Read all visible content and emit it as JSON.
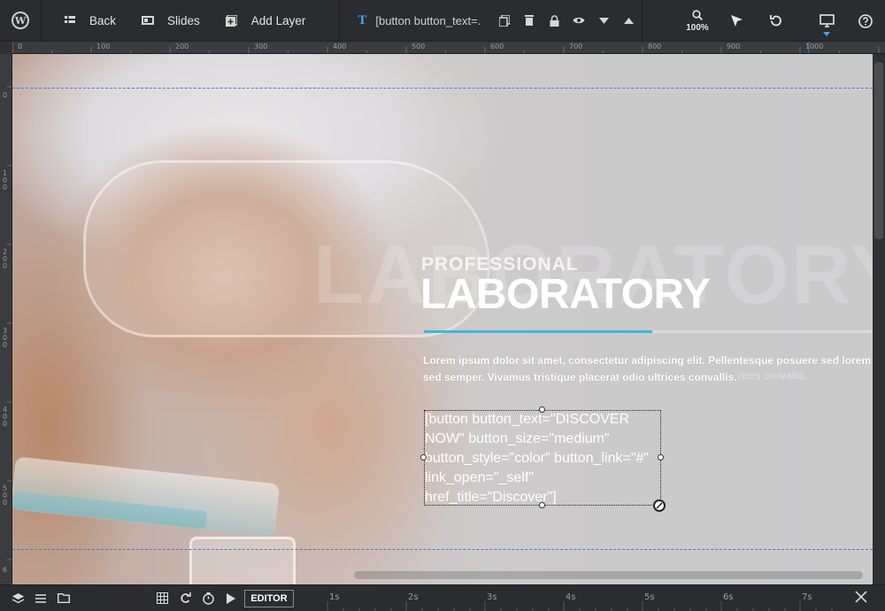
{
  "toolbar": {
    "wp_logo": "W",
    "back_label": "Back",
    "slides_label": "Slides",
    "add_layer_label": "Add Layer",
    "layer_type_icon": "T",
    "layer_name": "[button button_text=.",
    "zoom_label": "100%"
  },
  "rulers": {
    "top": [
      "0",
      "100",
      "200",
      "300",
      "400",
      "500",
      "600",
      "700",
      "800",
      "900",
      "1000"
    ],
    "left": [
      "0",
      "1\n0\n0",
      "2\n0\n0",
      "3\n0\n0",
      "4\n0\n0",
      "5\n0\n0",
      "6"
    ]
  },
  "slide": {
    "ghost_text": "LABORATORY",
    "subtitle": "PROFESSIONAL",
    "title": "LABORATORY",
    "paragraph": "Lorem ipsum dolor sit amet, consectetur adipiscing elit. Pellentesque posuere sed lorem sed semper. Vivamus tristique placerat odio ultrices convallis.",
    "paragraph_ghost": "rices convallis.",
    "selected_layer_text": "[button button_text=\"DISCOVER NOW\" button_size=\"medium\" button_style=\"color\" button_link=\"#\" link_open=\"_self\" href_title=\"Discover\"]",
    "accent_color": "#3fb6da"
  },
  "bottom": {
    "editor_label": "EDITOR",
    "timeline": [
      "1s",
      "2s",
      "3s",
      "4s",
      "5s",
      "6s",
      "7s"
    ]
  }
}
